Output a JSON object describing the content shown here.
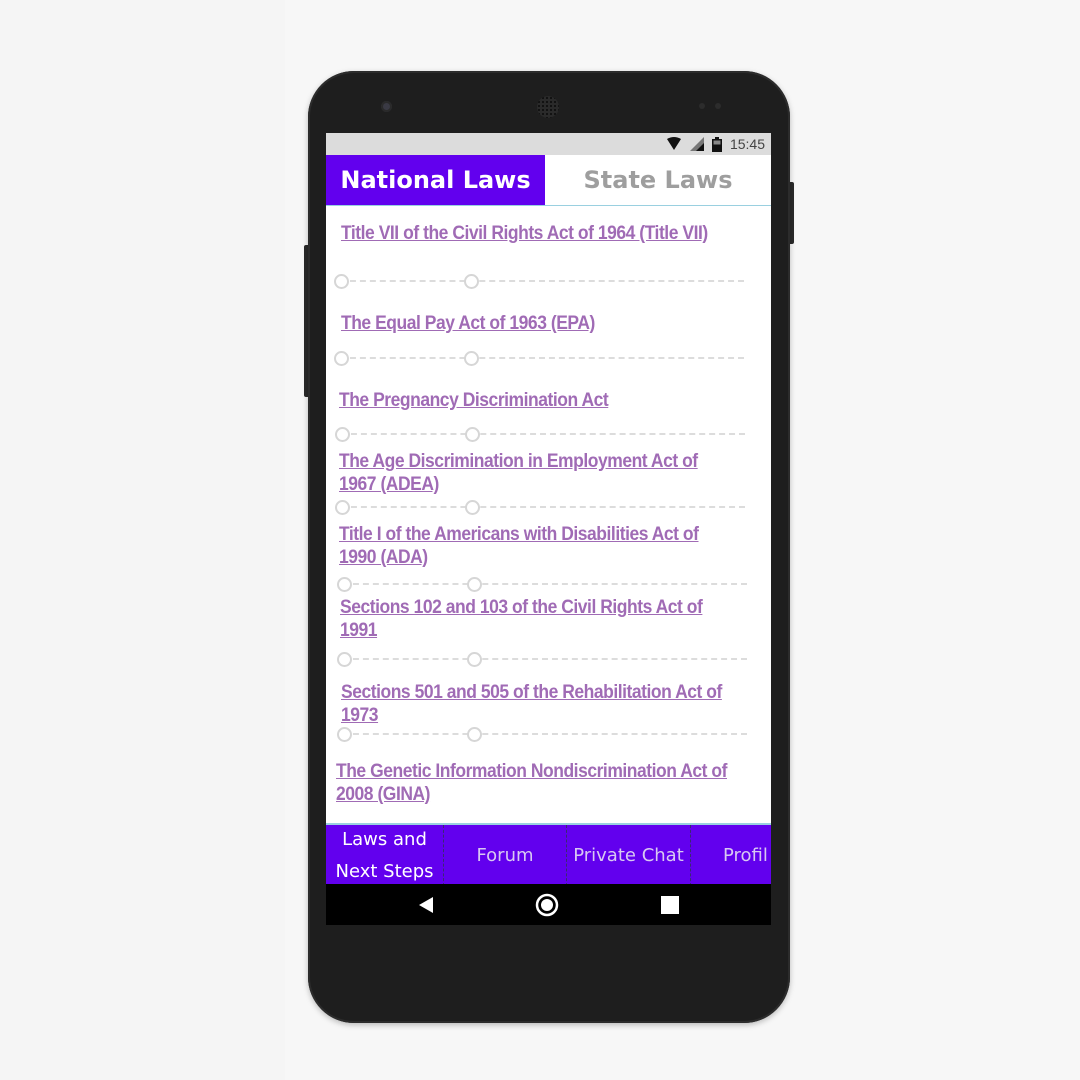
{
  "status_bar": {
    "time": "15:45"
  },
  "tabs": {
    "national": "National Laws",
    "state": "State Laws"
  },
  "laws": [
    "Title VII of the Civil Rights Act of 1964 (Title VII)",
    "The Equal Pay Act of 1963 (EPA)",
    "The Pregnancy Discrimination Act",
    "The Age Discrimination in Employment Act of 1967 (ADEA)",
    "Title I of the Americans with Disabilities Act of 1990 (ADA)",
    "Sections 102 and 103 of the Civil Rights Act of 1991",
    "Sections 501 and 505 of the Rehabilitation Act of 1973",
    "The Genetic Information Nondiscrimination Act of 2008 (GINA)"
  ],
  "bottom_nav": {
    "laws_line1": "Laws and",
    "laws_line2": "Next Steps",
    "forum": "Forum",
    "private_chat": "Private Chat",
    "profile": "Profil"
  },
  "colors": {
    "accent": "#6200ee",
    "link": "#a06bb5",
    "inactive_tab": "#9e9e9e"
  },
  "icons": [
    "wifi-icon",
    "signal-icon",
    "battery-icon",
    "back-icon",
    "home-icon",
    "recents-icon"
  ]
}
